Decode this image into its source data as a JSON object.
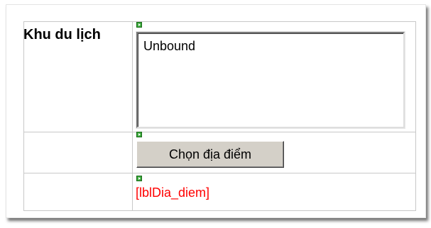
{
  "form": {
    "row1_label": "Khu du lịch",
    "textarea_value": "Unbound",
    "button_label": "Chọn địa điểm",
    "label_control": "[lblDia_diem]"
  },
  "colors": {
    "label_control": "#ff0000",
    "button_bg": "#d4d0c8",
    "marker": "#3caa3c"
  }
}
